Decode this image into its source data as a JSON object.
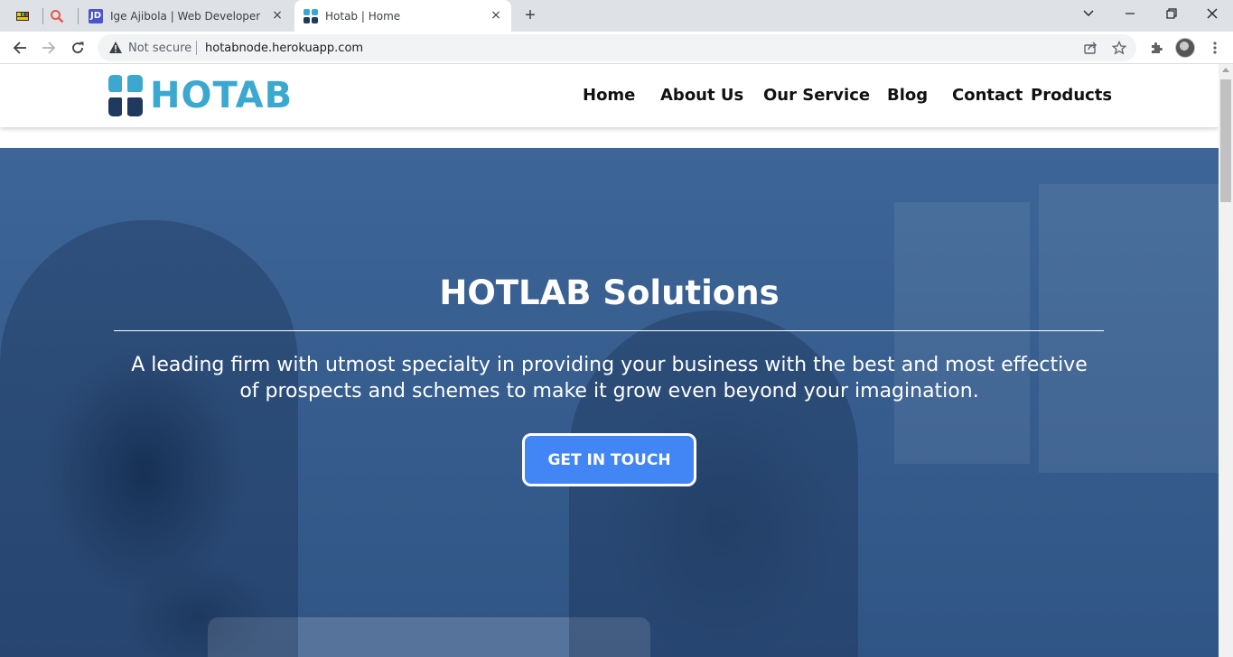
{
  "browser": {
    "tabs": [
      {
        "label": "",
        "pinned": true,
        "icon": "colorful-grid-favicon"
      },
      {
        "label": "",
        "pinned": true,
        "icon": "magnifier-favicon"
      },
      {
        "label": "Ige Ajibola | Web Developer",
        "icon": "jd-favicon",
        "icon_text": "JD"
      },
      {
        "label": "Hotab | Home",
        "icon": "hotab-favicon",
        "active": true
      }
    ],
    "security_label": "Not secure",
    "url": "hotabnode.herokuapp.com"
  },
  "site": {
    "logo_text": "HOTAB",
    "brand_color": "#3aa8cf",
    "nav": [
      "Home",
      "About Us",
      "Our Service",
      "Blog",
      "Contact",
      "Products"
    ]
  },
  "hero": {
    "title": "HOTLAB Solutions",
    "subtitle": "A leading firm with utmost specialty in providing your business with the best and most effective of prospects and schemes to make it grow even beyond your imagination.",
    "cta_label": "GET IN TOUCH",
    "cta_color": "#4285f4",
    "overlay_color": "#2f5a8e"
  }
}
